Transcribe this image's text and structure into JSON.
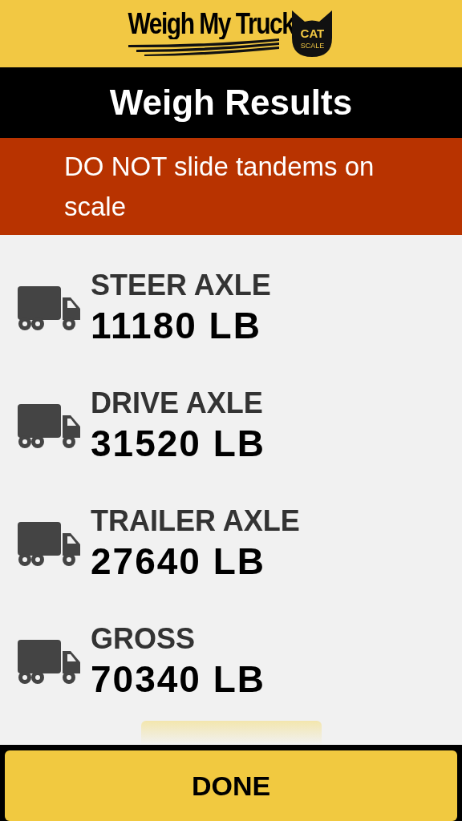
{
  "logo": {
    "wordmark": "Weigh My Truck",
    "badge_top": "CAT",
    "badge_bottom": "SCALE"
  },
  "title": "Weigh Results",
  "warning": "DO NOT slide tandems on scale",
  "results": [
    {
      "label": "STEER AXLE",
      "weight": "11180 LB"
    },
    {
      "label": "DRIVE AXLE",
      "weight": "31520 LB"
    },
    {
      "label": "TRAILER AXLE",
      "weight": "27640 LB"
    },
    {
      "label": "GROSS",
      "weight": "70340 LB"
    }
  ],
  "done_button": "DONE"
}
